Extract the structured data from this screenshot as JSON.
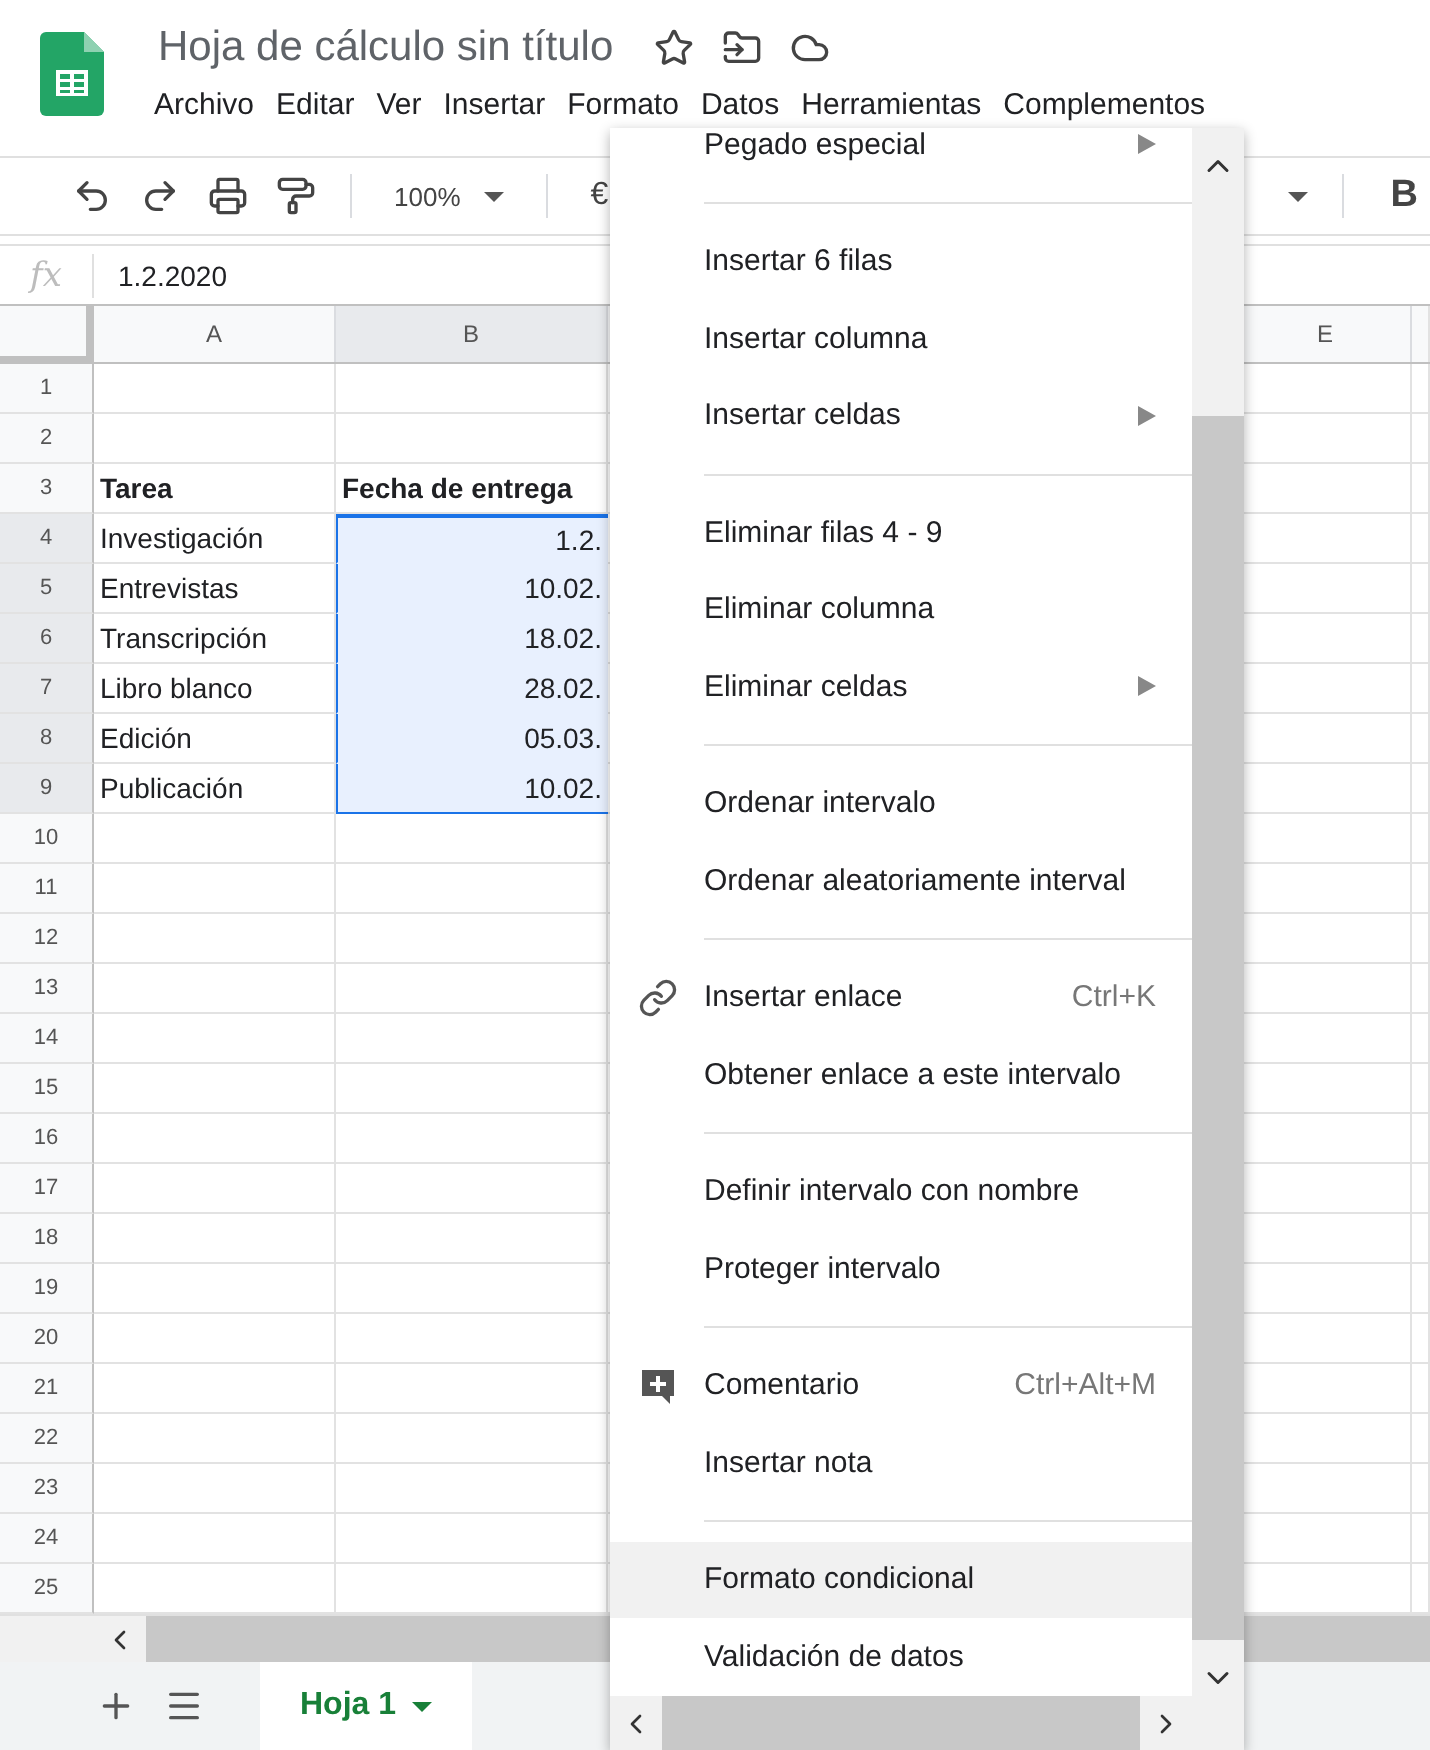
{
  "document": {
    "title": "Hoja de cálculo sin título"
  },
  "menu_bar": [
    "Archivo",
    "Editar",
    "Ver",
    "Insertar",
    "Formato",
    "Datos",
    "Herramientas",
    "Complementos"
  ],
  "toolbar": {
    "zoom": "100%",
    "currency": "€",
    "bold": "B"
  },
  "formula_bar": {
    "label": "fx",
    "value": "1.2.2020"
  },
  "columns": [
    {
      "label": "A",
      "selected": false
    },
    {
      "label": "B",
      "selected": true
    },
    {
      "label": "E",
      "selected": false
    }
  ],
  "rows": [
    {
      "number": "1",
      "selected": false
    },
    {
      "number": "2",
      "selected": false
    },
    {
      "number": "3",
      "selected": false,
      "cells": [
        {
          "text": "Tarea",
          "bold": true
        },
        {
          "text": "Fecha de entrega",
          "bold": true
        }
      ]
    },
    {
      "number": "4",
      "selected": true,
      "cells": [
        {
          "text": "Investigación"
        },
        {
          "text": "1.2.",
          "kind": "date"
        }
      ]
    },
    {
      "number": "5",
      "selected": true,
      "cells": [
        {
          "text": "Entrevistas"
        },
        {
          "text": "10.02.",
          "kind": "date"
        }
      ]
    },
    {
      "number": "6",
      "selected": true,
      "cells": [
        {
          "text": "Transcripción"
        },
        {
          "text": "18.02.",
          "kind": "date"
        }
      ]
    },
    {
      "number": "7",
      "selected": true,
      "cells": [
        {
          "text": "Libro blanco"
        },
        {
          "text": "28.02.",
          "kind": "date"
        }
      ]
    },
    {
      "number": "8",
      "selected": true,
      "cells": [
        {
          "text": "Edición"
        },
        {
          "text": "05.03.",
          "kind": "date"
        }
      ]
    },
    {
      "number": "9",
      "selected": true,
      "cells": [
        {
          "text": "Publicación"
        },
        {
          "text": "10.02.",
          "kind": "date"
        }
      ]
    },
    {
      "number": "10",
      "selected": false
    },
    {
      "number": "11",
      "selected": false
    },
    {
      "number": "12",
      "selected": false
    },
    {
      "number": "13",
      "selected": false
    },
    {
      "number": "14",
      "selected": false
    },
    {
      "number": "15",
      "selected": false
    },
    {
      "number": "16",
      "selected": false
    },
    {
      "number": "17",
      "selected": false
    },
    {
      "number": "18",
      "selected": false
    },
    {
      "number": "19",
      "selected": false
    },
    {
      "number": "20",
      "selected": false
    },
    {
      "number": "21",
      "selected": false
    },
    {
      "number": "22",
      "selected": false
    },
    {
      "number": "23",
      "selected": false
    },
    {
      "number": "24",
      "selected": false
    },
    {
      "number": "25",
      "selected": false
    }
  ],
  "context_menu": [
    {
      "kind": "item",
      "label": "Pegado especial",
      "submenu": true,
      "selected": false
    },
    {
      "kind": "separator"
    },
    {
      "kind": "item",
      "label": "Insertar 6 filas",
      "selected": false
    },
    {
      "kind": "item",
      "label": "Insertar columna",
      "selected": false
    },
    {
      "kind": "item",
      "label": "Insertar celdas",
      "submenu": true,
      "selected": false
    },
    {
      "kind": "separator"
    },
    {
      "kind": "item",
      "label": "Eliminar filas 4 - 9",
      "selected": false
    },
    {
      "kind": "item",
      "label": "Eliminar columna",
      "selected": false
    },
    {
      "kind": "item",
      "label": "Eliminar celdas",
      "submenu": true,
      "selected": false
    },
    {
      "kind": "separator"
    },
    {
      "kind": "item",
      "label": "Ordenar intervalo",
      "selected": false
    },
    {
      "kind": "item",
      "label": "Ordenar aleatoriamente interval",
      "selected": false
    },
    {
      "kind": "separator"
    },
    {
      "kind": "link",
      "label": "Insertar enlace",
      "shortcut": "Ctrl+K",
      "selected": false
    },
    {
      "kind": "item",
      "label": "Obtener enlace a este intervalo",
      "selected": false
    },
    {
      "kind": "separator"
    },
    {
      "kind": "item",
      "label": "Definir intervalo con nombre",
      "selected": false
    },
    {
      "kind": "item",
      "label": "Proteger intervalo",
      "selected": false
    },
    {
      "kind": "separator"
    },
    {
      "kind": "comment",
      "label": "Comentario",
      "shortcut": "Ctrl+Alt+M",
      "selected": false
    },
    {
      "kind": "item",
      "label": "Insertar nota",
      "selected": false
    },
    {
      "kind": "separator"
    },
    {
      "kind": "item",
      "label": "Formato condicional",
      "selected": true
    },
    {
      "kind": "item",
      "label": "Validación de datos",
      "selected": false
    }
  ],
  "sheet_tabs": [
    {
      "label": "Hoja 1",
      "selected": true
    }
  ]
}
